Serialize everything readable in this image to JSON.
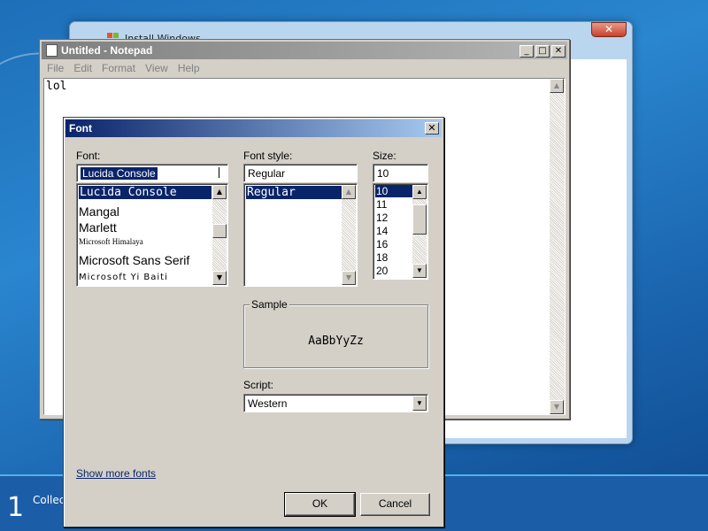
{
  "desktop": {
    "step_number": "1",
    "step_text": "Collec"
  },
  "install_window": {
    "title": "Install Windows",
    "close_label": "✕"
  },
  "notepad": {
    "title": "Untitled - Notepad",
    "menu": [
      "File",
      "Edit",
      "Format",
      "View",
      "Help"
    ],
    "content": "lol",
    "buttons": {
      "minimize": "_",
      "maximize": "□",
      "close": "✕"
    }
  },
  "font_dialog": {
    "title": "Font",
    "close_label": "✕",
    "font_label": "Font:",
    "font_value": "Lucida Console",
    "font_list": [
      {
        "label": "Lucida Console",
        "selected": true
      },
      {
        "label": "Mangal",
        "selected": false
      },
      {
        "label": "Marlett",
        "selected": false
      },
      {
        "label": "Microsoft Himalaya",
        "selected": false
      },
      {
        "label": "Microsoft Sans Serif",
        "selected": false
      },
      {
        "label": "Microsoft Yi Baiti",
        "selected": false
      }
    ],
    "style_label": "Font style:",
    "style_value": "Regular",
    "style_list": [
      {
        "label": "Regular",
        "selected": true
      }
    ],
    "size_label": "Size:",
    "size_value": "10",
    "size_list": [
      {
        "label": "10",
        "selected": true
      },
      {
        "label": "11",
        "selected": false
      },
      {
        "label": "12",
        "selected": false
      },
      {
        "label": "14",
        "selected": false
      },
      {
        "label": "16",
        "selected": false
      },
      {
        "label": "18",
        "selected": false
      },
      {
        "label": "20",
        "selected": false
      }
    ],
    "sample_label": "Sample",
    "sample_text": "AaBbYyZz",
    "script_label": "Script:",
    "script_value": "Western",
    "more_fonts_link": "Show more fonts",
    "ok_label": "OK",
    "cancel_label": "Cancel"
  },
  "colors": {
    "selection": "#0a246a",
    "dialog_face": "#d4d0c8",
    "desktop_blue": "#1d6fb8"
  }
}
